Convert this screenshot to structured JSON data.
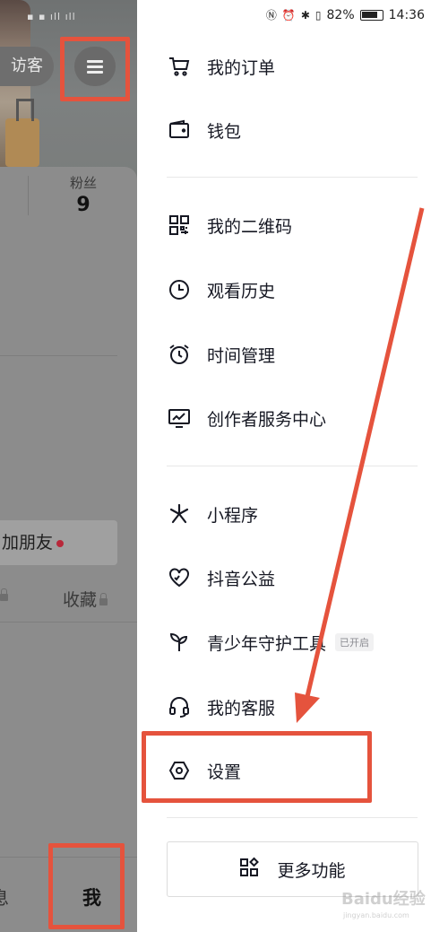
{
  "status_bar": {
    "battery": "82%",
    "time": "14:36"
  },
  "profile_behind": {
    "visitor_label": "访客",
    "fans_label": "粉丝",
    "fans_count": "9",
    "add_friend_label": "加朋友",
    "collect_label": "收藏",
    "tab_messages": "息",
    "tab_me": "我"
  },
  "drawer": {
    "groups": [
      [
        {
          "icon": "cart-icon",
          "label": "我的订单"
        },
        {
          "icon": "wallet-icon",
          "label": "钱包"
        }
      ],
      [
        {
          "icon": "qrcode-icon",
          "label": "我的二维码"
        },
        {
          "icon": "clock-icon",
          "label": "观看历史"
        },
        {
          "icon": "alarm-icon",
          "label": "时间管理"
        },
        {
          "icon": "chart-monitor-icon",
          "label": "创作者服务中心"
        }
      ],
      [
        {
          "icon": "mini-program-icon",
          "label": "小程序"
        },
        {
          "icon": "heart-charity-icon",
          "label": "抖音公益"
        },
        {
          "icon": "sprout-icon",
          "label": "青少年守护工具",
          "badge": "已开启"
        },
        {
          "icon": "headset-icon",
          "label": "我的客服"
        },
        {
          "icon": "settings-hex-icon",
          "label": "设置"
        }
      ]
    ],
    "more_label": "更多功能"
  },
  "watermark": {
    "text": "Baidu经验",
    "sub": "jingyan.baidu.com"
  },
  "colors": {
    "highlight": "#e5533d",
    "text": "#161823"
  }
}
